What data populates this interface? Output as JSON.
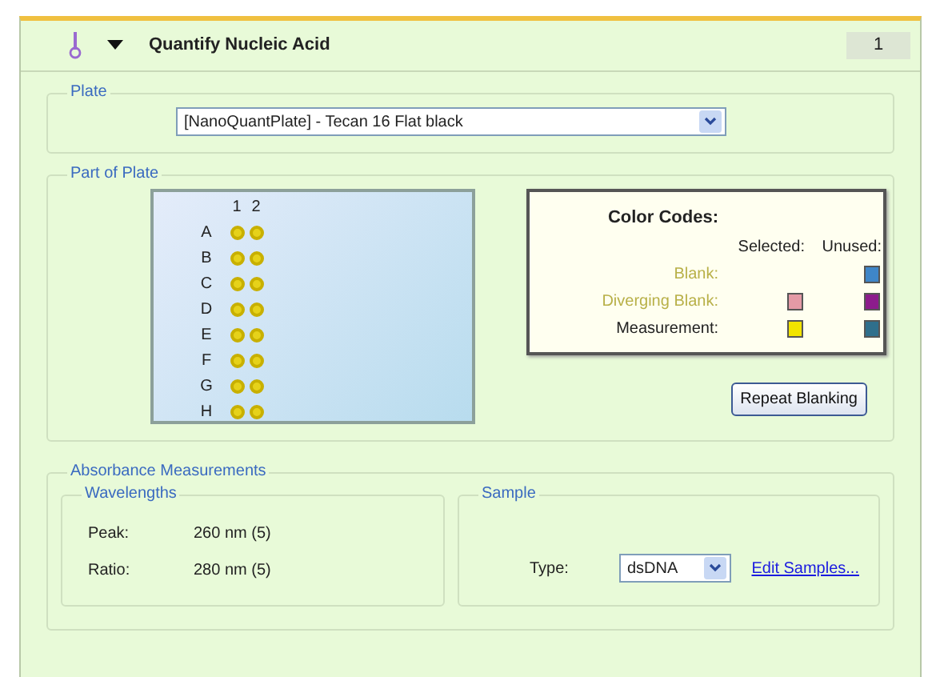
{
  "header": {
    "title": "Quantify Nucleic Acid",
    "expanded": true,
    "number": "1"
  },
  "plate": {
    "legend": "Plate",
    "selection": "[NanoQuantPlate] - Tecan 16 Flat black"
  },
  "part_of_plate": {
    "legend": "Part of Plate",
    "columns": [
      "1",
      "2"
    ],
    "rows": [
      "A",
      "B",
      "C",
      "D",
      "E",
      "F",
      "G",
      "H"
    ],
    "color_codes": {
      "title": "Color Codes:",
      "headers": [
        "Selected:",
        "Unused:"
      ],
      "items": [
        {
          "label": "Blank:",
          "kind": "blank",
          "unused": {
            "color": "#3f86c8"
          }
        },
        {
          "label": "Diverging Blank:",
          "kind": "blank",
          "selected": {
            "color": "#e49aa6"
          },
          "unused": {
            "color": "#8c1c8c"
          }
        },
        {
          "label": "Measurement:",
          "kind": "measurement",
          "selected": {
            "color": "#f2e400"
          },
          "unused": {
            "color": "#2f6f8c"
          }
        }
      ]
    },
    "button": "Repeat Blanking"
  },
  "absorbance": {
    "legend": "Absorbance Measurements",
    "wavelengths": {
      "legend": "Wavelengths",
      "rows": [
        {
          "label": "Peak:",
          "value": "260 nm (5)"
        },
        {
          "label": "Ratio:",
          "value": "280 nm (5)"
        }
      ]
    },
    "sample": {
      "legend": "Sample",
      "type_label": "Type:",
      "type_value": "dsDNA",
      "link": "Edit Samples..."
    }
  }
}
